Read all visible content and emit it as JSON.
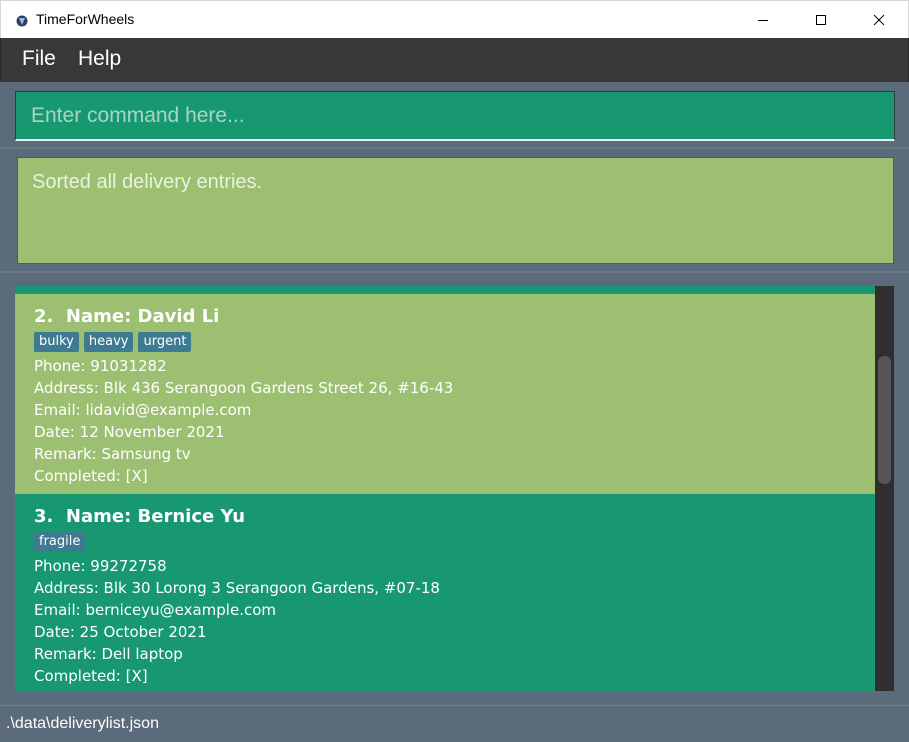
{
  "window": {
    "title": "TimeForWheels",
    "icon": "app-logo-icon"
  },
  "menu": {
    "file": "File",
    "help": "Help"
  },
  "command": {
    "placeholder": "Enter command here...",
    "value": ""
  },
  "result": {
    "message": "Sorted all delivery entries."
  },
  "deliveries": [
    {
      "index": "2.",
      "name": "Name: David Li",
      "tags": [
        "bulky",
        "heavy",
        "urgent"
      ],
      "phone": "Phone: 91031282",
      "address": "Address: Blk 436 Serangoon Gardens Street 26, #16-43",
      "email": "Email: lidavid@example.com",
      "date": "Date: 12 November 2021",
      "remark": "Remark: Samsung tv",
      "completed": "Completed: [X]"
    },
    {
      "index": "3.",
      "name": "Name: Bernice Yu",
      "tags": [
        "fragile"
      ],
      "phone": "Phone: 99272758",
      "address": "Address: Blk 30 Lorong 3 Serangoon Gardens, #07-18",
      "email": "Email: berniceyu@example.com",
      "date": "Date: 25 October 2021",
      "remark": "Remark: Dell laptop",
      "completed": "Completed: [X]"
    }
  ],
  "status": {
    "file_path": ".\\data\\deliverylist.json"
  },
  "colors": {
    "command_bg": "#179870",
    "result_bg": "#9dbf72",
    "tag_bg": "#3e7b91",
    "panel_bg": "#5b6b7b",
    "menubar_bg": "#383838"
  }
}
